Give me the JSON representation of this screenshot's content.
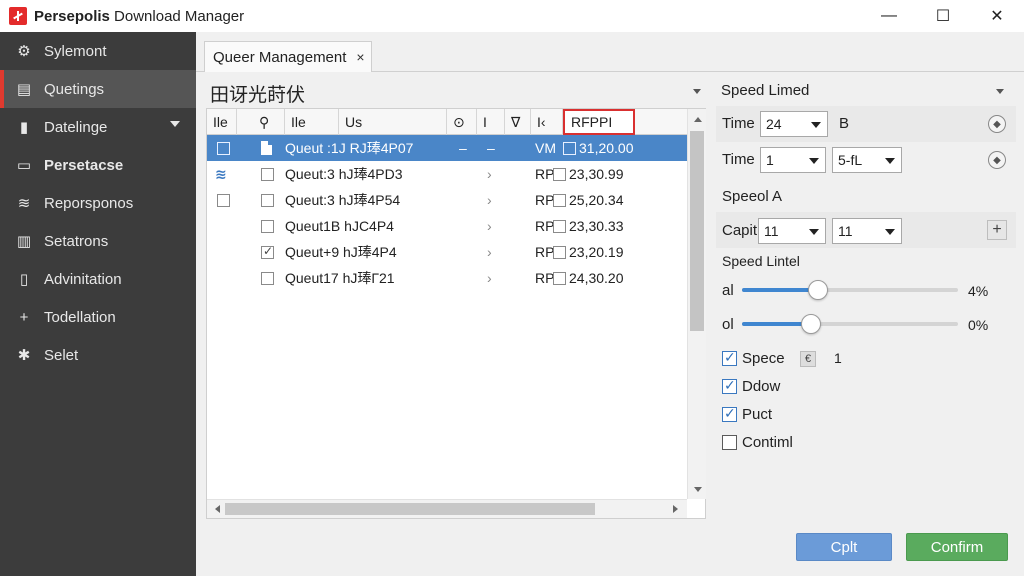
{
  "titlebar": {
    "title_bold": "Persepolis",
    "title_rest": " Download Manager",
    "minimize": "—",
    "maximize": "☐",
    "close": "✕"
  },
  "sidebar": {
    "items": [
      {
        "label": "Sylemont",
        "icon": "⚙"
      },
      {
        "label": "Quetings",
        "icon": "▤"
      },
      {
        "label": "Datelinge",
        "icon": "▮"
      },
      {
        "label": "Persetacse",
        "icon": "▭"
      },
      {
        "label": "Reporsponos",
        "icon": "≋"
      },
      {
        "label": "Setatrons",
        "icon": "▥"
      },
      {
        "label": "Advinitation",
        "icon": "▯"
      },
      {
        "label": "Todellation",
        "icon": "+"
      },
      {
        "label": "Selet",
        "icon": "✱"
      }
    ],
    "accent": "#e03a2f"
  },
  "tab": {
    "label": "Queer Management",
    "close": "×"
  },
  "section_title": "田讶光莳伏",
  "table": {
    "headers": [
      "Ile",
      "⚲",
      "Ile",
      "Us",
      "⊙",
      "I",
      "∇",
      "I‹",
      "RFPPI"
    ],
    "rows": [
      {
        "name": "Queut :1J RJ琫4P07",
        "c1": "–",
        "c2": "–",
        "c3": "VM",
        "value": "31,20.00",
        "checked": false
      },
      {
        "name": "Queut:3 hJ琫4PD3",
        "c1": "",
        "c2": "›",
        "c3": "RP",
        "value": "23,30.99",
        "checked": false
      },
      {
        "name": "Queut:3 hJ琫4P54",
        "c1": "",
        "c2": "›",
        "c3": "RP",
        "value": "25,20.34",
        "checked": false
      },
      {
        "name": "Queut1B hJC4P4",
        "c1": "",
        "c2": "›",
        "c3": "RP",
        "value": "23,30.33",
        "checked": false
      },
      {
        "name": "Queut+9 hJ琫4P4",
        "c1": "",
        "c2": "›",
        "c3": "RP",
        "value": "23,20.19",
        "checked": true
      },
      {
        "name": "Queut17 hJ琫Г21",
        "c1": "",
        "c2": "›",
        "c3": "RP",
        "value": "24,30.20",
        "checked": false
      }
    ]
  },
  "right_panel": {
    "speed_limited": "Speed Limed",
    "time1_label": "Time",
    "time1_value": "24",
    "time1_unit": "B",
    "time2_label": "Time",
    "time2_value": "1",
    "time2_value2": "5-fL",
    "speed_a": "Speeol A",
    "capit_label": "Capit",
    "capit_value1": "11",
    "capit_value2": "11",
    "plus": "+",
    "speed_limit": "Speed Lintel",
    "slider1_label": "al",
    "slider1_value": "4%",
    "slider1_fraction": 0.35,
    "slider2_label": "ol",
    "slider2_value": "0%",
    "slider2_fraction": 0.32,
    "checks": [
      {
        "label": "Spece",
        "checked": true,
        "extra_box": "€",
        "extra_value": "1"
      },
      {
        "label": "Ddow",
        "checked": true
      },
      {
        "label": "Puct",
        "checked": true
      },
      {
        "label": "Contiml",
        "checked": false
      }
    ]
  },
  "buttons": {
    "cancel": "Cplt",
    "confirm": "Confirm"
  },
  "colors": {
    "selected_row": "#4a86c8",
    "confirm": "#5aab5e",
    "cancel": "#6b9bd8"
  }
}
